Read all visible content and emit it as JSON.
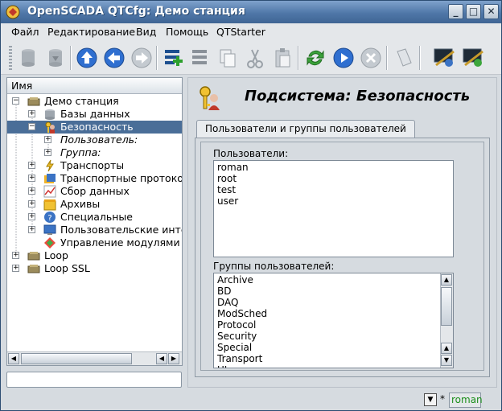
{
  "window": {
    "title": "OpenSCADA QTCfg: Демо станция"
  },
  "menubar": {
    "file": "Файл",
    "edit": "Редактирование",
    "view": "Вид",
    "help": "Помощь",
    "starter": "QTStarter"
  },
  "tree": {
    "header": "Имя",
    "items": [
      {
        "label": "Демо станция",
        "icon": "station-icon"
      },
      {
        "label": "Базы данных",
        "icon": "database-icon"
      },
      {
        "label": "Безопасность",
        "icon": "security-icon"
      },
      {
        "label": "Пользователь:",
        "icon": ""
      },
      {
        "label": "Группа:",
        "icon": ""
      },
      {
        "label": "Транспорты",
        "icon": "transport-icon"
      },
      {
        "label": "Транспортные протоколы",
        "icon": "protocol-icon"
      },
      {
        "label": "Сбор данных",
        "icon": "daq-icon"
      },
      {
        "label": "Архивы",
        "icon": "archive-icon"
      },
      {
        "label": "Специальные",
        "icon": "special-icon"
      },
      {
        "label": "Пользовательские интерф",
        "icon": "ui-icon"
      },
      {
        "label": "Управление модулями",
        "icon": "modules-icon"
      },
      {
        "label": "Loop",
        "icon": "station-icon"
      },
      {
        "label": "Loop SSL",
        "icon": "station-icon"
      }
    ]
  },
  "main": {
    "title": "Подсистема: Безопасность",
    "tab": "Пользователи и группы пользователей",
    "users_label": "Пользователи:",
    "users": [
      "roman",
      "root",
      "test",
      "user"
    ],
    "groups_label": "Группы пользователей:",
    "groups": [
      "Archive",
      "BD",
      "DAQ",
      "ModSched",
      "Protocol",
      "Security",
      "Special",
      "Transport",
      "UI"
    ]
  },
  "status": {
    "modified_mark": "*",
    "user": "roman"
  },
  "colors": {
    "selection": "#4a6e98",
    "titlebar": "#4f77a8",
    "user_text": "#1b8f1b"
  }
}
